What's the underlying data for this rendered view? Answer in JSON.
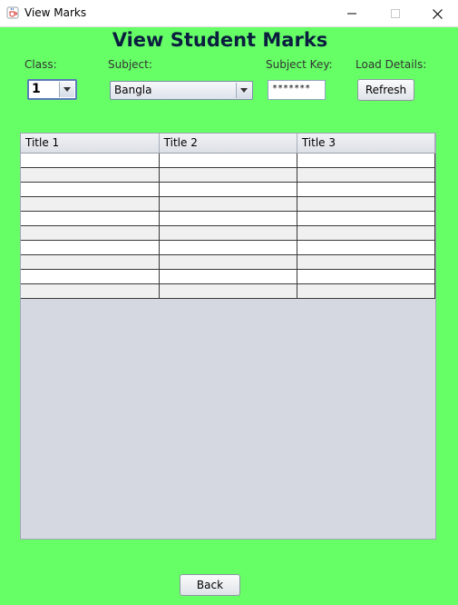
{
  "window": {
    "title": "View Marks"
  },
  "heading": "View Student Marks",
  "labels": {
    "class": "Class:",
    "subject": "Subject:",
    "subject_key": "Subject Key:",
    "load_details": "Load Details:"
  },
  "class_select": {
    "value": "1"
  },
  "subject_select": {
    "value": "Bangla"
  },
  "subject_key": {
    "value": "*******"
  },
  "buttons": {
    "refresh": "Refresh",
    "back": "Back"
  },
  "table": {
    "columns": [
      "Title 1",
      "Title 2",
      "Title 3"
    ],
    "row_count": 10
  },
  "colors": {
    "background": "#66ff66",
    "heading": "#0b1e3f"
  },
  "icons": {
    "app": "java-cup-icon",
    "minimize": "minimize-icon",
    "maximize": "maximize-icon",
    "close": "close-icon"
  }
}
